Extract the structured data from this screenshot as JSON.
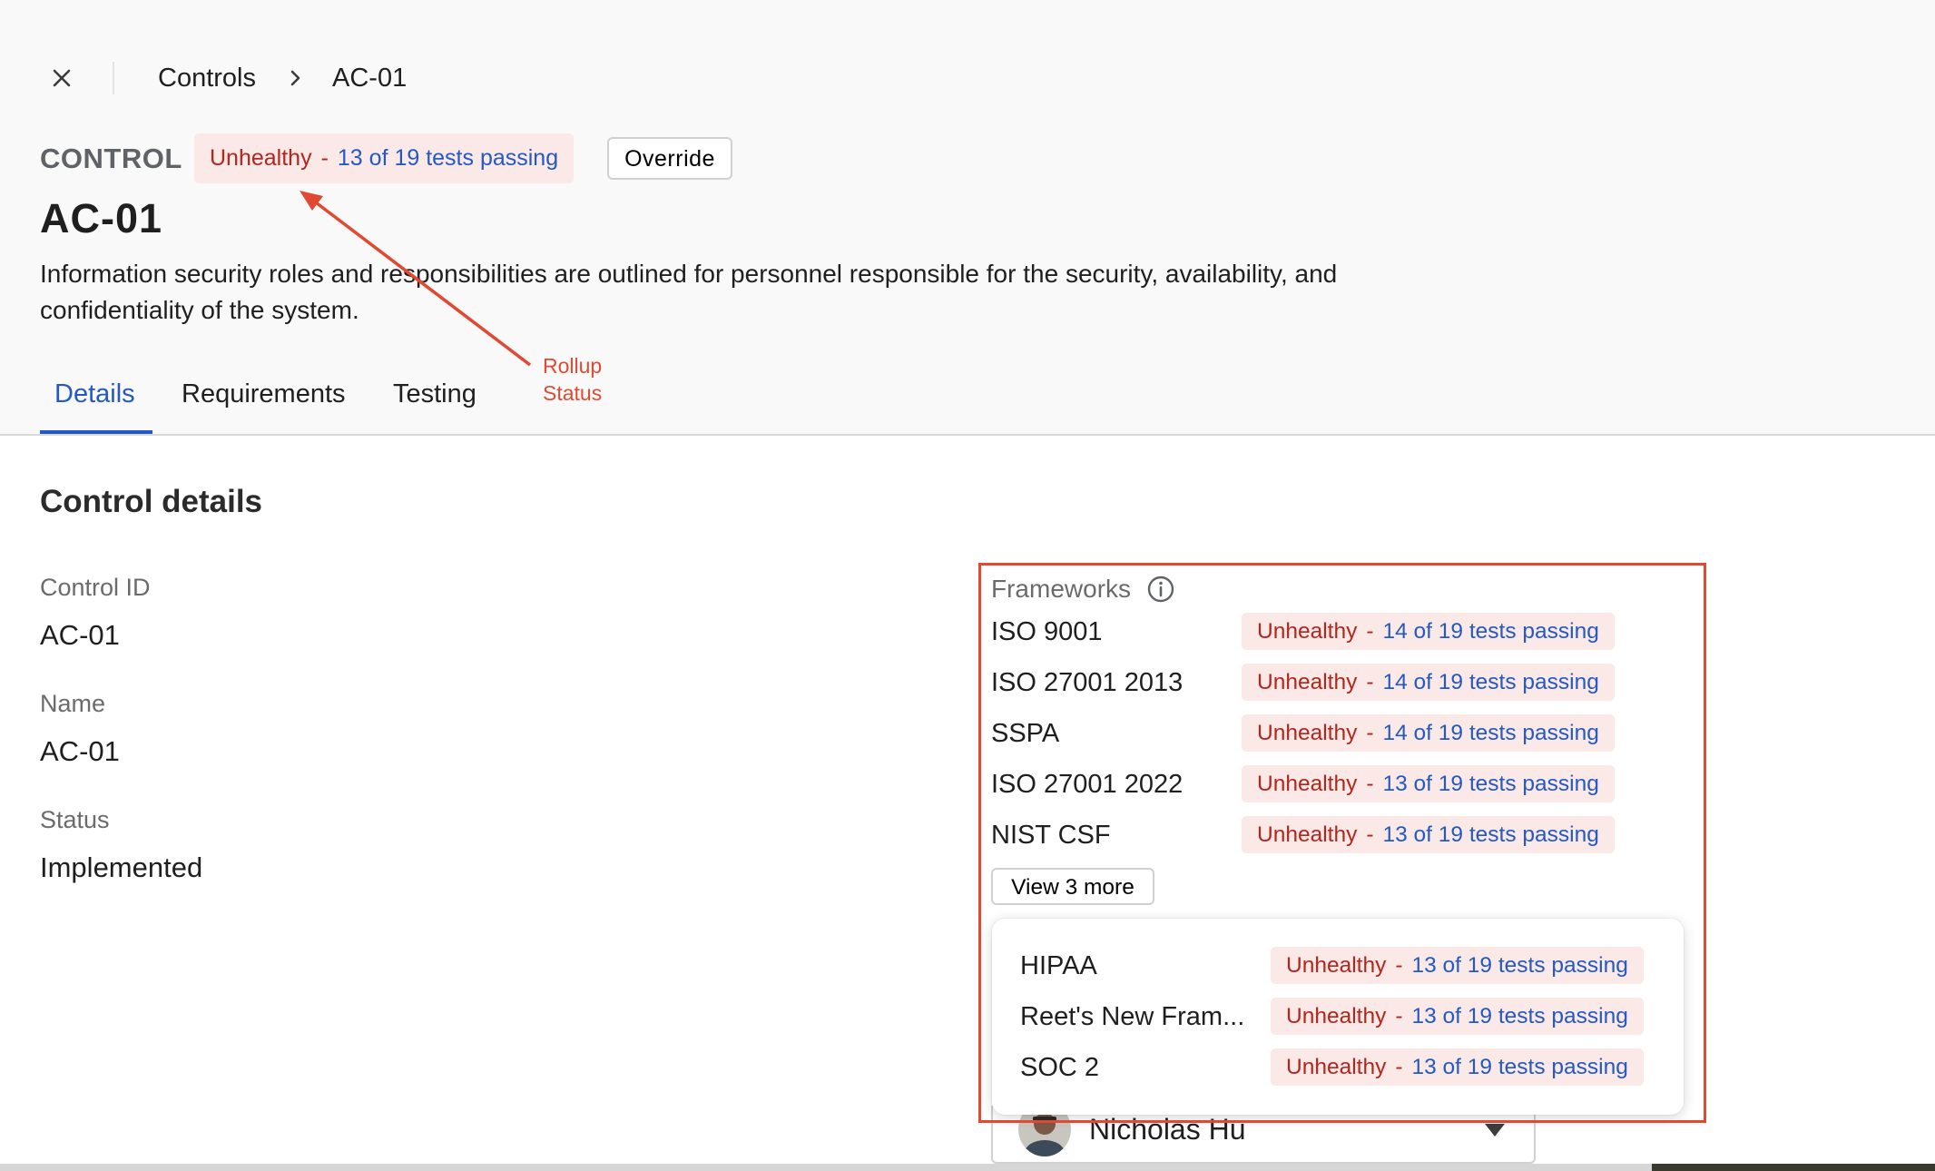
{
  "breadcrumb": {
    "root": "Controls",
    "current": "AC-01"
  },
  "header": {
    "eyebrow": "CONTROL",
    "status": {
      "health": "Unhealthy",
      "separator": "-",
      "tests": "13 of 19 tests passing"
    },
    "override_label": "Override",
    "title": "AC-01",
    "description": "Information security roles and responsibilities are outlined for personnel responsible for the security, availability, and confidentiality of the system."
  },
  "annotation": {
    "line1": "Rollup",
    "line2": "Status"
  },
  "tabs": [
    {
      "label": "Details",
      "active": true
    },
    {
      "label": "Requirements",
      "active": false
    },
    {
      "label": "Testing",
      "active": false
    }
  ],
  "details": {
    "section_title": "Control details",
    "fields": [
      {
        "label": "Control ID",
        "value": "AC-01"
      },
      {
        "label": "Name",
        "value": "AC-01"
      },
      {
        "label": "Status",
        "value": "Implemented"
      }
    ]
  },
  "frameworks": {
    "label": "Frameworks",
    "items": [
      {
        "name": "ISO 9001",
        "health": "Unhealthy",
        "separator": "-",
        "tests": "14 of 19 tests passing"
      },
      {
        "name": "ISO 27001 2013",
        "health": "Unhealthy",
        "separator": "-",
        "tests": "14 of 19 tests passing"
      },
      {
        "name": "SSPA",
        "health": "Unhealthy",
        "separator": "-",
        "tests": "14 of 19 tests passing"
      },
      {
        "name": "ISO 27001 2022",
        "health": "Unhealthy",
        "separator": "-",
        "tests": "13 of 19 tests passing"
      },
      {
        "name": "NIST CSF",
        "health": "Unhealthy",
        "separator": "-",
        "tests": "13 of 19 tests passing"
      }
    ],
    "view_more_label": "View 3 more",
    "more_items": [
      {
        "name": "HIPAA",
        "health": "Unhealthy",
        "separator": "-",
        "tests": "13 of 19 tests passing"
      },
      {
        "name": "Reet's New Fram...",
        "health": "Unhealthy",
        "separator": "-",
        "tests": "13 of 19 tests passing"
      },
      {
        "name": "SOC 2",
        "health": "Unhealthy",
        "separator": "-",
        "tests": "13 of 19 tests passing"
      }
    ]
  },
  "owner": {
    "name": "Nicholas Hu"
  },
  "colors": {
    "accent": "#2459c4",
    "unhealthy": "#b3261e",
    "pill_bg": "#fae9e6",
    "annotation": "#e14a32"
  }
}
